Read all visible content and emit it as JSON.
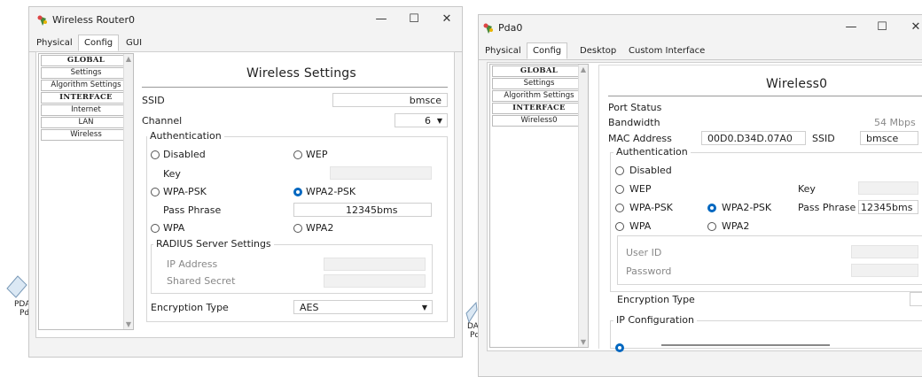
{
  "router_window": {
    "title": "Wireless Router0",
    "controls": {
      "minimize": "—",
      "maximize": "☐",
      "close": "✕"
    },
    "tabs": [
      "Physical",
      "Config",
      "GUI"
    ],
    "nav": [
      "GLOBAL",
      "Settings",
      "Algorithm Settings",
      "INTERFACE",
      "Internet",
      "LAN",
      "Wireless"
    ],
    "heading": "Wireless Settings",
    "ssid_label": "SSID",
    "ssid_value": "bmsce",
    "channel_label": "Channel",
    "channel_value": "6",
    "auth_legend": "Authentication",
    "disabled": "Disabled",
    "wep": "WEP",
    "key": "Key",
    "wpa_psk": "WPA-PSK",
    "wpa2_psk": "WPA2-PSK",
    "pass_phrase": "Pass Phrase",
    "pass_value": "12345bms",
    "wpa": "WPA",
    "wpa2": "WPA2",
    "radius_legend": "RADIUS Server Settings",
    "ip_address": "IP Address",
    "shared_secret": "Shared Secret",
    "encryption_label": "Encryption Type",
    "encryption_value": "AES"
  },
  "pda_window": {
    "title": "Pda0",
    "controls": {
      "minimize": "—",
      "maximize": "☐",
      "close": "✕"
    },
    "tabs": [
      "Physical",
      "Config",
      "Desktop",
      "Custom Interface"
    ],
    "nav": [
      "GLOBAL",
      "Settings",
      "Algorithm Settings",
      "INTERFACE",
      "Wireless0"
    ],
    "heading": "Wireless0",
    "port_status": "Port Status",
    "bandwidth": "Bandwidth",
    "bandwidth_value": "54 Mbps",
    "mac_label": "MAC Address",
    "mac_value": "00D0.D34D.07A0",
    "ssid_label": "SSID",
    "ssid_value": "bmsce",
    "auth_legend": "Authentication",
    "disabled": "Disabled",
    "wep": "WEP",
    "key": "Key",
    "wpa_psk": "WPA-PSK",
    "wpa2_psk": "WPA2-PSK",
    "pass_phrase": "Pass Phrase",
    "pass_value": "12345bms",
    "wpa": "WPA",
    "wpa2": "WPA2",
    "user_id": "User ID",
    "password": "Password",
    "encryption_label": "Encryption Type",
    "ip_config": "IP Configuration"
  },
  "background_devices": {
    "left_label": "PDA",
    "left_label2": "Pd",
    "right_label": "DA",
    "right_label2": "Pd"
  },
  "colors": {
    "radio_selected": "#0067c0",
    "window_bg": "#f3f3f3"
  }
}
